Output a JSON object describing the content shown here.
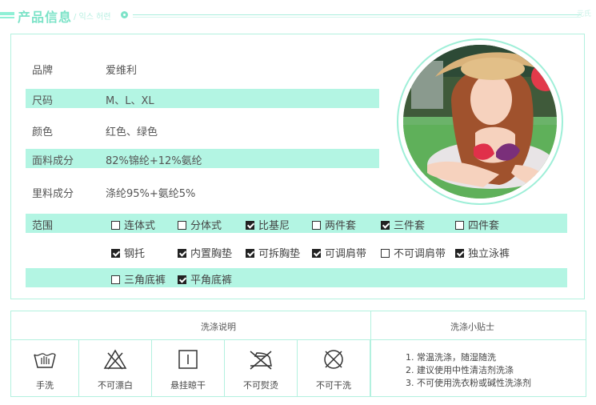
{
  "header": {
    "title": "产品信息",
    "subtitle": "/ 익스 허련",
    "corner": "元氏"
  },
  "specs": [
    {
      "key": "品牌",
      "value": "爱维利"
    },
    {
      "key": "尺码",
      "value": "M、L、XL"
    },
    {
      "key": "颜色",
      "value": "红色、绿色"
    },
    {
      "key": "面料成分",
      "value": "82%锦纶+12%氨纶"
    },
    {
      "key": "里料成分",
      "value": "涤纶95%+氨纶5%"
    }
  ],
  "scope": {
    "label": "范围",
    "rows": [
      [
        {
          "label": "连体式",
          "checked": false
        },
        {
          "label": "分体式",
          "checked": false
        },
        {
          "label": "比基尼",
          "checked": true
        },
        {
          "label": "两件套",
          "checked": false
        },
        {
          "label": "三件套",
          "checked": true
        },
        {
          "label": "四件套",
          "checked": false
        }
      ],
      [
        {
          "label": "钢托",
          "checked": true
        },
        {
          "label": "内置胸垫",
          "checked": true
        },
        {
          "label": "可拆胸垫",
          "checked": true
        },
        {
          "label": "可调肩带",
          "checked": true
        },
        {
          "label": "不可调肩带",
          "checked": false
        },
        {
          "label": "独立泳裤",
          "checked": true
        }
      ],
      [
        {
          "label": "三角底裤",
          "checked": false
        },
        {
          "label": "平角底裤",
          "checked": true
        }
      ]
    ]
  },
  "care": {
    "heading_left": "洗涤说明",
    "heading_right": "洗涤小贴士",
    "icons": [
      {
        "label": "手洗",
        "icon": "hand-wash-icon"
      },
      {
        "label": "不可漂白",
        "icon": "no-bleach-icon"
      },
      {
        "label": "悬挂晾干",
        "icon": "hang-dry-icon"
      },
      {
        "label": "不可熨烫",
        "icon": "no-iron-icon"
      },
      {
        "label": "不可干洗",
        "icon": "no-dry-clean-icon"
      }
    ],
    "tips": [
      "1.  常温洗涤，随湿随洗",
      "2.  建议使用中性清洁剂洗涤",
      "3.  不可使用洗衣粉或碱性洗涤剂"
    ]
  },
  "colors": {
    "accent": "#b3f5e3",
    "title": "#7de3c8",
    "border": "#b3f1df"
  }
}
